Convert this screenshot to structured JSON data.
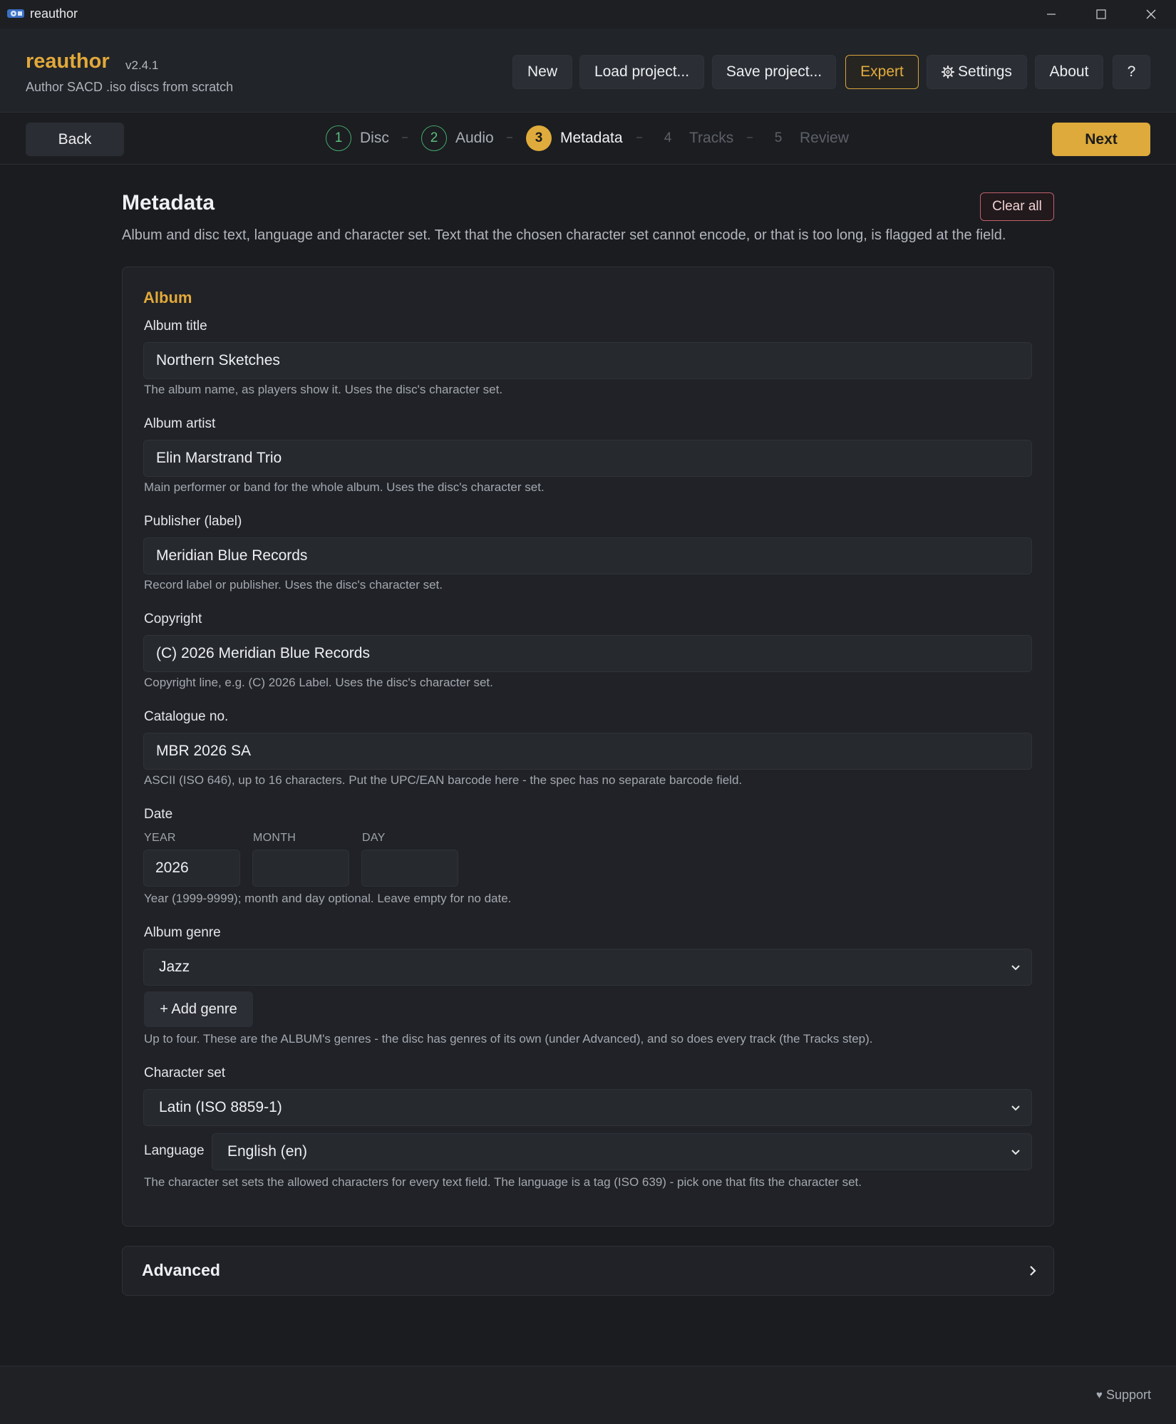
{
  "window": {
    "title": "reauthor"
  },
  "header": {
    "app_name": "reauthor",
    "version": "v2.4.1",
    "tagline": "Author SACD .iso discs from scratch",
    "buttons": {
      "new": "New",
      "load": "Load project...",
      "save": "Save project...",
      "expert": "Expert",
      "settings": "Settings",
      "about": "About",
      "help": "?"
    },
    "accent_color": "#e2a93a"
  },
  "wizard": {
    "back": "Back",
    "next": "Next",
    "steps": [
      {
        "num": "1",
        "label": "Disc",
        "state": "done"
      },
      {
        "num": "2",
        "label": "Audio",
        "state": "done"
      },
      {
        "num": "3",
        "label": "Metadata",
        "state": "active"
      },
      {
        "num": "4",
        "label": "Tracks",
        "state": "todo"
      },
      {
        "num": "5",
        "label": "Review",
        "state": "todo"
      }
    ]
  },
  "page": {
    "title": "Metadata",
    "clear_all": "Clear all",
    "description": "Album and disc text, language and character set. Text that the chosen character set cannot encode, or that is too long, is flagged at the field."
  },
  "album": {
    "section_title": "Album",
    "title": {
      "label": "Album title",
      "value": "Northern Sketches",
      "hint": "The album name, as players show it. Uses the disc's character set."
    },
    "artist": {
      "label": "Album artist",
      "value": "Elin Marstrand Trio",
      "hint": "Main performer or band for the whole album. Uses the disc's character set."
    },
    "publisher": {
      "label": "Publisher (label)",
      "value": "Meridian Blue Records",
      "hint": "Record label or publisher. Uses the disc's character set."
    },
    "copyright": {
      "label": "Copyright",
      "value": "(C) 2026 Meridian Blue Records",
      "hint": "Copyright line, e.g. (C) 2026 Label. Uses the disc's character set."
    },
    "catalogue": {
      "label": "Catalogue no.",
      "value": "MBR 2026 SA",
      "hint": "ASCII (ISO 646), up to 16 characters. Put the UPC/EAN barcode here - the spec has no separate barcode field."
    },
    "date": {
      "label": "Date",
      "year_label": "YEAR",
      "month_label": "MONTH",
      "day_label": "DAY",
      "year": "2026",
      "month": "",
      "day": "",
      "hint": "Year (1999-9999); month and day optional. Leave empty for no date."
    },
    "genre": {
      "label": "Album genre",
      "value": "Jazz",
      "add": "+ Add genre",
      "hint": "Up to four. These are the ALBUM's genres - the disc has genres of its own (under Advanced), and so does every track (the Tracks step)."
    },
    "charset": {
      "label": "Character set",
      "value": "Latin (ISO 8859-1)"
    },
    "language": {
      "label": "Language",
      "value": "English (en)",
      "hint": "The character set sets the allowed characters for every text field. The language is a tag (ISO 639) - pick one that fits the character set."
    }
  },
  "advanced": {
    "label": "Advanced"
  },
  "footer": {
    "support": "Support"
  }
}
